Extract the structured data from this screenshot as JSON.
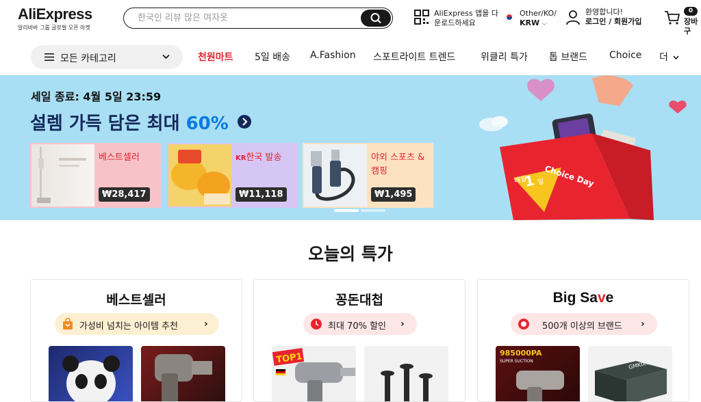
{
  "header": {
    "logo": "AliExpress",
    "logo_sub": "알리바바 그룹 글로벌 오픈 마켓",
    "search_placeholder": "한국인 리뷰 많은 여자옷",
    "app_line1": "AliExpress 앱을 다",
    "app_line2": "운로드하세요",
    "locale_line1": "Other/KO/",
    "locale_currency": "KRW",
    "account_line1": "환영합니다!",
    "account_line2": "로그인 / 회원가입",
    "cart_count": "0",
    "cart_label": "장바구"
  },
  "nav": {
    "categories": "모든 카테고리",
    "links": [
      "천원마트",
      "5일 배송",
      "A.Fashion",
      "스포트라이트 트렌드",
      "위클리 특가",
      "톱 브랜드",
      "Choice",
      "더"
    ],
    "active_color": "#e0222f"
  },
  "banner": {
    "sale_end": "세일 종료: 4월 5일 23:59",
    "title_main": "설렘 가득 담은 최대 ",
    "title_pct": "60%",
    "cards": [
      {
        "name": "베스트셀러",
        "price": "₩28,417",
        "bg": "#f7c3c8"
      },
      {
        "name_prefix": "KR",
        "name": "한국 발송",
        "price": "₩11,118",
        "bg": "#d6c6f4"
      },
      {
        "name": "야외 스포츠 &",
        "name2": "캠핑",
        "price": "₩1,495",
        "bg": "#fde2c2"
      }
    ],
    "bag_text1": "Choice Day",
    "bag_text2": "매월",
    "bag_text3": "1",
    "bag_text4": "일"
  },
  "deals": {
    "section_title": "오늘의 특가",
    "cards": [
      {
        "title": "베스트셀러",
        "pill": "가성비 넘치는 아이템 추천",
        "pill_bg": "#fdf0d2"
      },
      {
        "title": "꽁돈대첩",
        "pill": "최대 70% 할인",
        "pill_bg": "#fde6e6"
      },
      {
        "title_a": "Big Sa",
        "title_b": "v",
        "title_c": "e",
        "pill": "500개 이상의 브랜드",
        "pill_bg": "#fde6e6"
      }
    ],
    "product_labels": [
      "TOP1",
      "985000PA",
      "SUPER SUCTION",
      "GMKtec"
    ]
  }
}
